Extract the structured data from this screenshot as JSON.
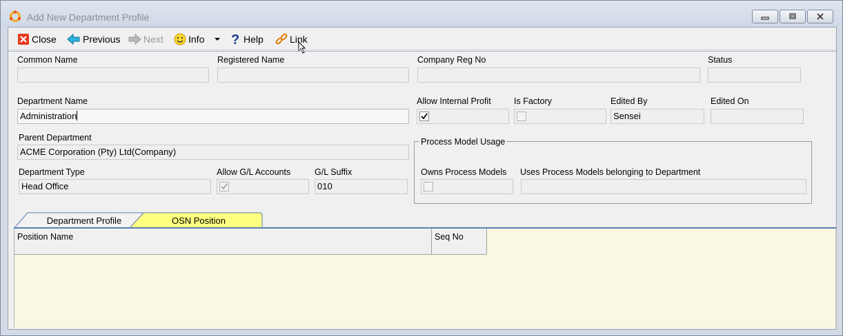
{
  "window": {
    "title": "Add New Department Profile",
    "icon": "refresh-ring-icon"
  },
  "toolbar": {
    "close": "Close",
    "previous": "Previous",
    "next": "Next",
    "info": "Info",
    "help": "Help",
    "link": "Link"
  },
  "form": {
    "common_name_label": "Common Name",
    "common_name_value": "",
    "registered_name_label": "Registered Name",
    "registered_name_value": "",
    "company_reg_no_label": "Company Reg No",
    "company_reg_no_value": "",
    "status_label": "Status",
    "status_value": "",
    "department_name_label": "Department Name",
    "department_name_value": "Administration",
    "allow_internal_profit_label": "Allow Internal Profit",
    "allow_internal_profit_checked": true,
    "is_factory_label": "Is Factory",
    "is_factory_checked": false,
    "edited_by_label": "Edited By",
    "edited_by_value": "Sensei",
    "edited_on_label": "Edited On",
    "edited_on_value": "",
    "parent_department_label": "Parent Department",
    "parent_department_value": "ACME Corporation (Pty) Ltd(Company)",
    "department_type_label": "Department Type",
    "department_type_value": "Head Office",
    "allow_gl_accounts_label": "Allow G/L Accounts",
    "allow_gl_accounts_checked": true,
    "gl_suffix_label": "G/L Suffix",
    "gl_suffix_value": "010"
  },
  "process_model_usage": {
    "title": "Process Model Usage",
    "owns_label": "Owns Process Models",
    "owns_checked": false,
    "uses_label": "Uses Process Models belonging to Department",
    "uses_value": ""
  },
  "tabs": [
    {
      "label": "Department Profile",
      "active": false
    },
    {
      "label": "OSN Position",
      "active": true
    }
  ],
  "grid": {
    "columns": [
      "Position Name",
      "Seq No"
    ]
  },
  "colors": {
    "active_tab": "#ffff80",
    "grid_background": "#fbf8e2",
    "tab_line": "#5b7fb3"
  }
}
